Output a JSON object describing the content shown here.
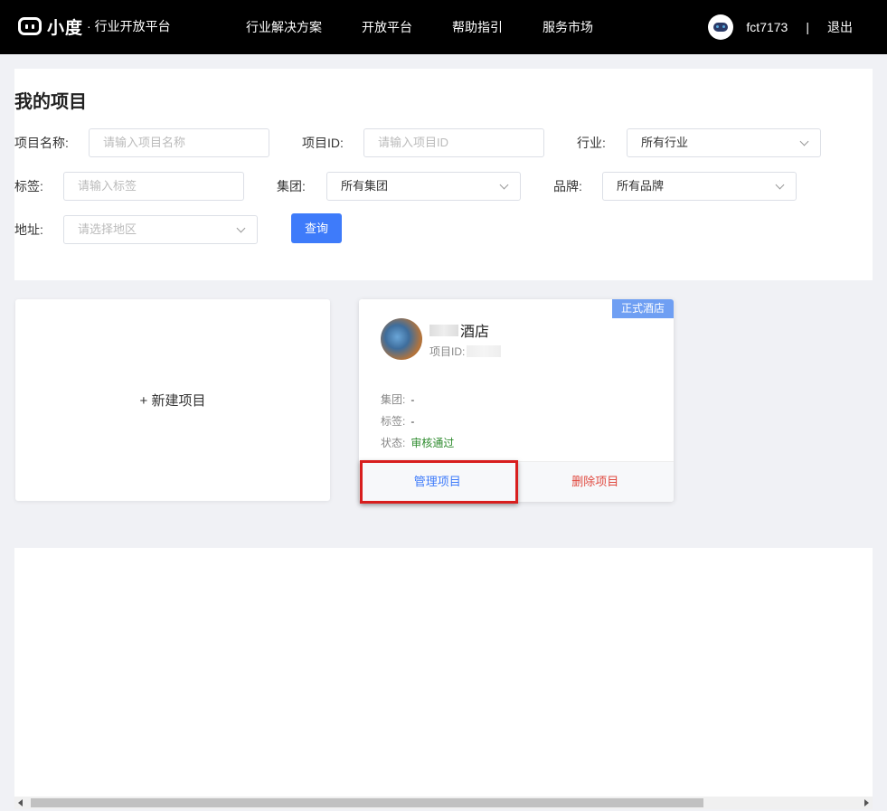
{
  "topbar": {
    "logo_text": "小度",
    "logo_sub": "· 行业开放平台",
    "nav": [
      "行业解决方案",
      "开放平台",
      "帮助指引",
      "服务市场"
    ],
    "username": "fct7173",
    "separator": "|",
    "logout": "退出"
  },
  "page": {
    "title": "我的项目"
  },
  "filters": {
    "project_name_label": "项目名称:",
    "project_name_placeholder": "请输入项目名称",
    "project_id_label": "项目ID:",
    "project_id_placeholder": "请输入项目ID",
    "industry_label": "行业:",
    "industry_value": "所有行业",
    "tag_label": "标签:",
    "tag_placeholder": "请输入标签",
    "group_label": "集团:",
    "group_value": "所有集团",
    "brand_label": "品牌:",
    "brand_value": "所有品牌",
    "address_label": "地址:",
    "address_placeholder": "请选择地区",
    "query_button": "查询"
  },
  "new_project": {
    "label": "+ 新建项目"
  },
  "project_card": {
    "badge": "正式酒店",
    "name_suffix": "酒店",
    "id_label": "项目ID:",
    "group_label": "集团:",
    "group_value": "-",
    "tag_label": "标签:",
    "tag_value": "-",
    "status_label": "状态:",
    "status_value": "审核通过",
    "status_color": "#2e8b2e",
    "manage_button": "管理项目",
    "delete_button": "删除项目"
  },
  "colors": {
    "primary": "#3e7bfa",
    "danger": "#e0483e",
    "highlight": "#d81e1e",
    "badge": "#6f9ff3"
  }
}
